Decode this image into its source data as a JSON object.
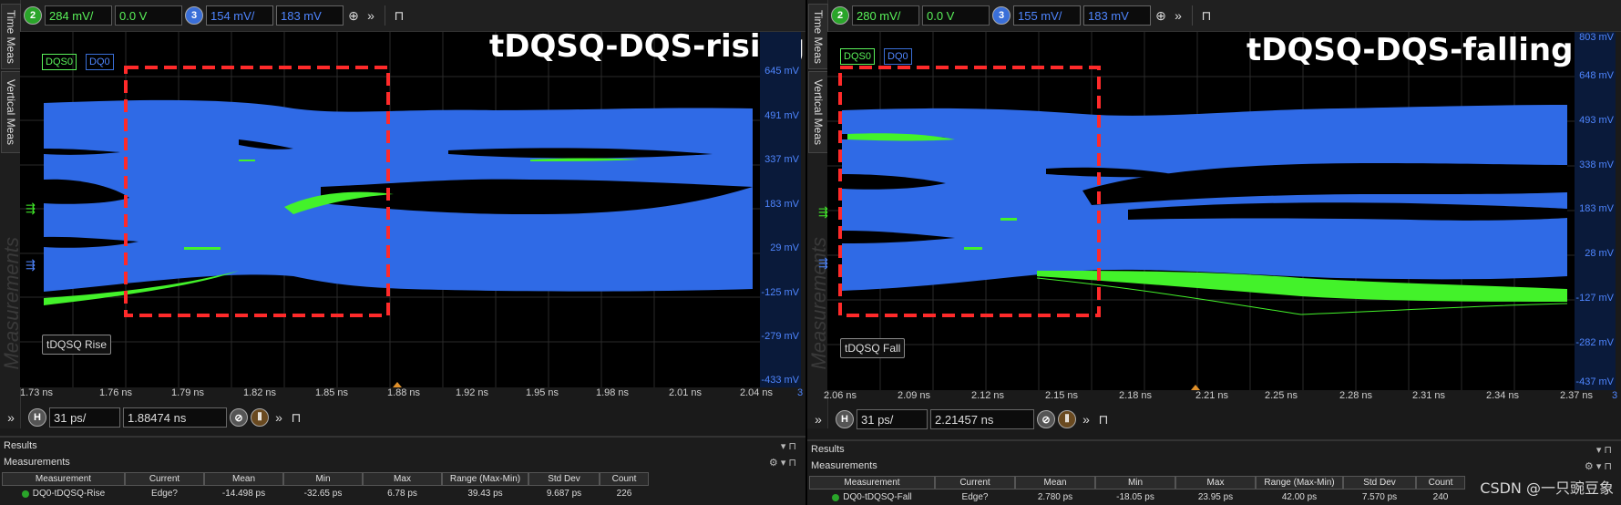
{
  "panels": [
    {
      "id": "left",
      "toolbar": {
        "ch2_badge": "2",
        "ch2_scale": "284 mV/",
        "ch2_offset": "0.0 V",
        "ch3_badge": "3",
        "ch3_scale": "154 mV/",
        "ch3_offset": "183 mV"
      },
      "side_tabs": [
        "Time Meas",
        "Vertical Meas"
      ],
      "watermark": "Measurements",
      "legend": [
        "DQS0",
        "DQ0"
      ],
      "title": "tDQSQ-DQS-rising",
      "meas_tag": "tDQSQ Rise",
      "y_ticks": [
        "645 mV",
        "491 mV",
        "337 mV",
        "183 mV",
        "29 mV",
        "-125 mV",
        "-279 mV",
        "-433 mV"
      ],
      "y_top_tick": "",
      "x_ticks": [
        "1.73 ns",
        "1.76 ns",
        "1.79 ns",
        "1.82 ns",
        "1.85 ns",
        "1.88 ns",
        "1.92 ns",
        "1.95 ns",
        "1.98 ns",
        "2.01 ns",
        "2.04 ns"
      ],
      "x_end": "3",
      "hbar": {
        "badge": "H",
        "scale": "31 ps/",
        "position": "1.88474 ns"
      },
      "results": {
        "title": "Results",
        "subtitle": "Measurements",
        "headers": [
          "Measurement",
          "Current",
          "Mean",
          "Min",
          "Max",
          "Range (Max-Min)",
          "Std Dev",
          "Count"
        ],
        "row": [
          "DQ0-tDQSQ-Rise",
          "Edge?",
          "-14.498 ps",
          "-32.65 ps",
          "6.78 ps",
          "39.43 ps",
          "9.687 ps",
          "226"
        ]
      }
    },
    {
      "id": "right",
      "toolbar": {
        "ch2_badge": "2",
        "ch2_scale": "280 mV/",
        "ch2_offset": "0.0 V",
        "ch3_badge": "3",
        "ch3_scale": "155 mV/",
        "ch3_offset": "183 mV"
      },
      "side_tabs": [
        "Time Meas",
        "Vertical Meas"
      ],
      "watermark": "Measurements",
      "legend": [
        "DQS0",
        "DQ0"
      ],
      "title": "tDQSQ-DQS-falling",
      "meas_tag": "tDQSQ Fall",
      "y_ticks": [
        "648 mV",
        "493 mV",
        "338 mV",
        "183 mV",
        "28 mV",
        "-127 mV",
        "-282 mV",
        "-437 mV"
      ],
      "y_top_tick": "803 mV",
      "x_ticks": [
        "2.06 ns",
        "2.09 ns",
        "2.12 ns",
        "2.15 ns",
        "2.18 ns",
        "2.21 ns",
        "2.25 ns",
        "2.28 ns",
        "2.31 ns",
        "2.34 ns",
        "2.37 ns"
      ],
      "x_end": "3",
      "hbar": {
        "badge": "H",
        "scale": "31 ps/",
        "position": "2.21457 ns"
      },
      "results": {
        "title": "Results",
        "subtitle": "Measurements",
        "headers": [
          "Measurement",
          "Current",
          "Mean",
          "Min",
          "Max",
          "Range (Max-Min)",
          "Std Dev",
          "Count"
        ],
        "row": [
          "DQ0-tDQSQ-Fall",
          "Edge?",
          "2.780 ps",
          "-18.05 ps",
          "23.95 ps",
          "42.00 ps",
          "7.570 ps",
          "240"
        ]
      }
    }
  ],
  "watermark_credit": "CSDN @一只豌豆象",
  "colors": {
    "dq_trace": "#2f6ae6",
    "dqs_trace": "#43f22a",
    "box": "#ff2a2a",
    "axis_blue": "#4f86ff"
  }
}
